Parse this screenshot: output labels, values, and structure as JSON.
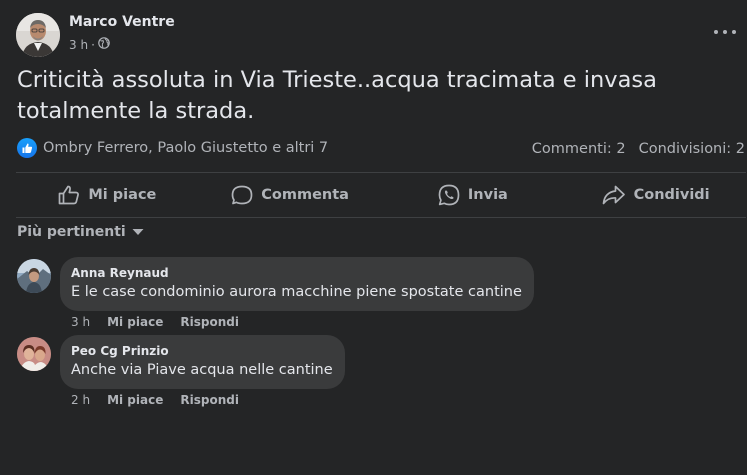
{
  "post": {
    "author": "Marco Ventre",
    "time": "3 h",
    "audience_icon": "globe-icon",
    "text": "Criticità assoluta in Via Trieste..acqua tracimata e invasa totalmente la strada.",
    "reaction_icon": "like-icon",
    "reactors": "Ombry Ferrero, Paolo Giustetto e altri 7",
    "comments_count": "Commenti: 2",
    "shares_count": "Condivisioni: 2"
  },
  "actions": {
    "like": "Mi piace",
    "comment": "Commenta",
    "send": "Invia",
    "share": "Condividi"
  },
  "filter": {
    "label": "Più pertinenti"
  },
  "comments": [
    {
      "name": "Anna Reynaud",
      "text": "E le case condominio aurora macchine piene spostate cantine",
      "time": "3 h",
      "like": "Mi piace",
      "reply": "Rispondi"
    },
    {
      "name": "Peo Cg Prinzio",
      "text": "Anche via Piave acqua nelle cantine",
      "time": "2 h",
      "like": "Mi piace",
      "reply": "Rispondi"
    }
  ],
  "colors": {
    "background": "#242526",
    "bubble": "#3a3b3c",
    "text_primary": "#e4e6eb",
    "text_secondary": "#b0b3b8",
    "like_blue": "#1877f2"
  }
}
